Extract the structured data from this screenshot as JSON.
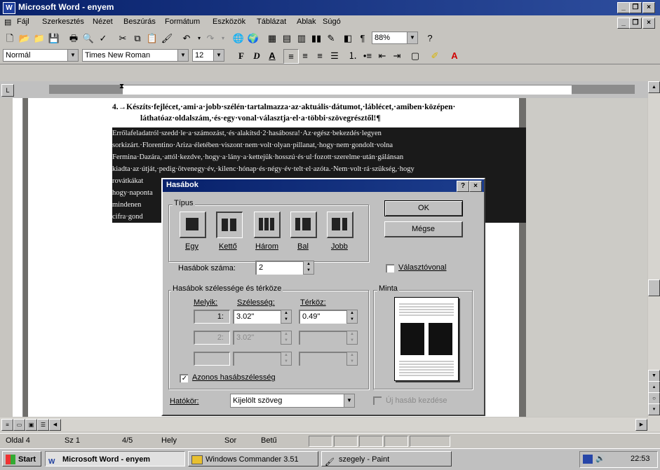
{
  "window": {
    "title": "Microsoft Word - enyem"
  },
  "menu": [
    "Fájl",
    "Szerkesztés",
    "Nézet",
    "Beszúrás",
    "Formátum",
    "Eszközök",
    "Táblázat",
    "Ablak",
    "Súgó"
  ],
  "toolbar": {
    "zoom": "88%"
  },
  "format": {
    "style": "Normál",
    "font": "Times New Roman",
    "size": "12",
    "bold": "F",
    "italic": "D",
    "underline": "A"
  },
  "document": {
    "line1": "4.→Készíts·fejlécet,·ami·a·jobb·szélén·tartalmazza·az·aktuális·dátumot,·láblécet,·amiben·középen·",
    "line2": "láthatóaz·oldalszám,·és·egy·vonal·választja·el·a·többi·szövegrésztől!¶",
    "hl": [
      "Errőlafeladatról·szedd·le·a·számozást,·és·alakítsd·2·hasábosra!·Az·egész·bekezdés·legyen",
      "sorkizárt.·Florentino·Ariza·életében·viszont·nem·volt·olyan·pillanat,·hogy·nem·gondolt·volna",
      "Fermina·Dazára,·attól·kezdve,·hogy·a·lány·a·kettejük·hosszú·és·ul·fozott·szerelme·után·gálánsan",
      "kiadta·az·útját,·pedig·ötvenegy·év,·kilenc·hónap·és·négy·év·telt·el·azóta.·Nem·volt·rá·szükség,·hogy",
      "rovátkákat",
      "hogy·naponta",
      "mindenen",
      "cifra·gond"
    ]
  },
  "dialog": {
    "title": "Hasábok",
    "help": "?",
    "close": "×",
    "type_label": "Típus",
    "presets": [
      "Egy",
      "Kettő",
      "Három",
      "Bal",
      "Jobb"
    ],
    "ok": "OK",
    "cancel": "Mégse",
    "count_label": "Hasábok száma:",
    "count_value": "2",
    "separator_label": "Választóvonal",
    "width_group": "Hasábok szélessége és térköze",
    "col_num": "Melyik:",
    "col_width": "Szélesség:",
    "col_spacing": "Térköz:",
    "rows": [
      {
        "num": "1:",
        "width": "3.02\"",
        "spacing": "0.49\""
      },
      {
        "num": "2:",
        "width": "3.02\"",
        "spacing": ""
      },
      {
        "num": "",
        "width": "",
        "spacing": ""
      }
    ],
    "preview_label": "Minta",
    "equal_label": "Azonos hasábszélesség",
    "apply_label": "Hatókör:",
    "apply_value": "Kijelölt szöveg",
    "newcol_label": "Új hasáb kezdése"
  },
  "status": {
    "page": "Oldal 4",
    "section": "Sz 1",
    "pages": "4/5",
    "pos": "Hely",
    "line": "Sor",
    "col": "Betű"
  },
  "taskbar": {
    "start": "Start",
    "tasks": [
      "Microsoft Word - enyem",
      "Windows Commander 3.51",
      "szegely - Paint"
    ],
    "clock": "22:53"
  }
}
